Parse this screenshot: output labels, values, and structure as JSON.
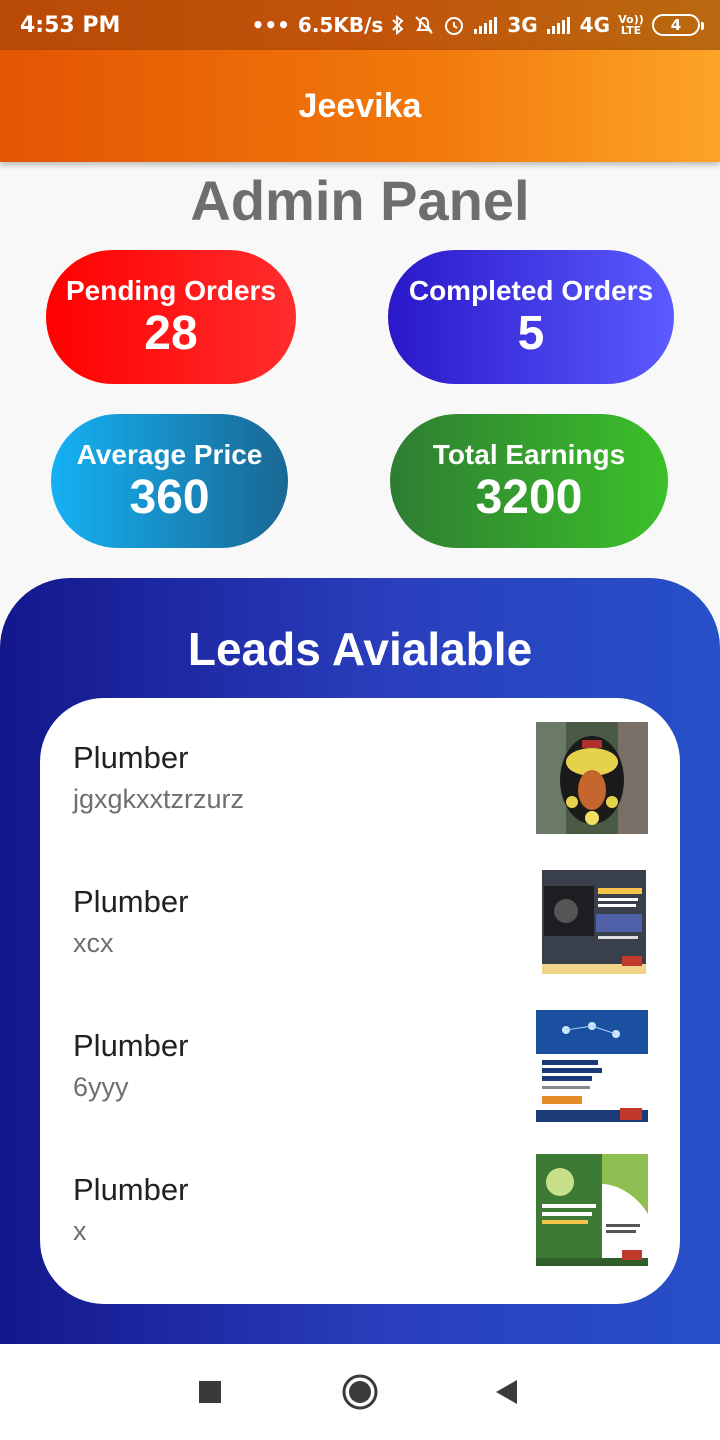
{
  "status_bar": {
    "time": "4:53 PM",
    "network_speed": "6.5KB/s",
    "net1": "3G",
    "net2": "4G",
    "volte": "Vo)) LTE",
    "battery": "4"
  },
  "app_bar": {
    "title": "Jeevika"
  },
  "panel": {
    "title": "Admin Panel"
  },
  "stats": {
    "pending": {
      "label": "Pending Orders",
      "value": "28"
    },
    "completed": {
      "label": "Completed Orders",
      "value": "5"
    },
    "average": {
      "label": "Average Price",
      "value": "360"
    },
    "earnings": {
      "label": "Total Earnings",
      "value": "3200"
    }
  },
  "leads": {
    "title": "Leads Avialable",
    "items": [
      {
        "name": "Plumber",
        "desc": "jgxgkxxtzrzurz"
      },
      {
        "name": "Plumber",
        "desc": "xcx"
      },
      {
        "name": "Plumber",
        "desc": "6yyy"
      },
      {
        "name": "Plumber",
        "desc": "x"
      }
    ]
  },
  "nav": {
    "icons": [
      "recents-square-icon",
      "home-circle-icon",
      "back-triangle-icon"
    ]
  }
}
